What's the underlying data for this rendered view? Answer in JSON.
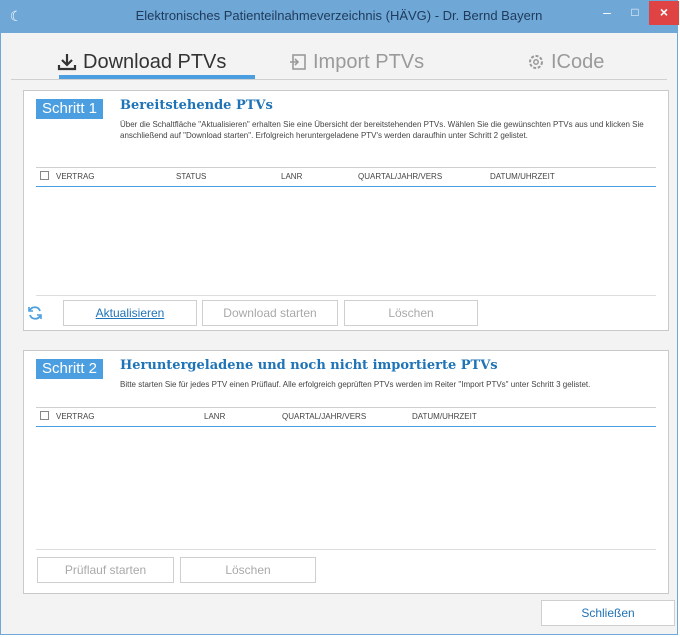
{
  "window": {
    "title": "Elektronisches Patienteilnahmeverzeichnis (HÄVG) - Dr. Bernd Bayern",
    "controls": {
      "minimize": "–",
      "maximize": "□",
      "close": "×"
    }
  },
  "tabs": [
    {
      "label": "Download PTVs",
      "icon": "download-icon",
      "active": true
    },
    {
      "label": "Import PTVs",
      "icon": "import-icon",
      "active": false
    },
    {
      "label": "ICode",
      "icon": "gear-icon",
      "active": false
    }
  ],
  "step1": {
    "badge": "Schritt 1",
    "title": "Bereitstehende PTVs",
    "description": "Über die Schaltfläche \"Aktualisieren\" erhalten Sie eine Übersicht der bereitstehenden PTVs. Wählen Sie die gewünschten PTVs aus und klicken Sie anschließend auf \"Download starten\". Erfolgreich heruntergeladene PTV's werden daraufhin unter Schritt 2 gelistet.",
    "columns": [
      "VERTRAG",
      "STATUS",
      "LANR",
      "QUARTAL/JAHR/VERS",
      "DATUM/UHRZEIT"
    ],
    "buttons": {
      "refresh": "Aktualisieren",
      "download": "Download starten",
      "delete": "Löschen"
    }
  },
  "step2": {
    "badge": "Schritt 2",
    "title": "Heruntergeladene und noch nicht importierte PTVs",
    "description": "Bitte starten Sie für jedes PTV einen Prüflauf. Alle erfolgreich geprüften PTVs werden im Reiter \"Import PTVs\" unter Schritt 3 gelistet.",
    "columns": [
      "VERTRAG",
      "LANR",
      "QUARTAL/JAHR/VERS",
      "DATUM/UHRZEIT"
    ],
    "buttons": {
      "check": "Prüflauf starten",
      "delete": "Löschen"
    }
  },
  "footer": {
    "close": "Schließen"
  },
  "colors": {
    "accent": "#4b9ee0",
    "titlebar": "#6fa7d6",
    "close": "#e04343",
    "link": "#1f73b7"
  }
}
